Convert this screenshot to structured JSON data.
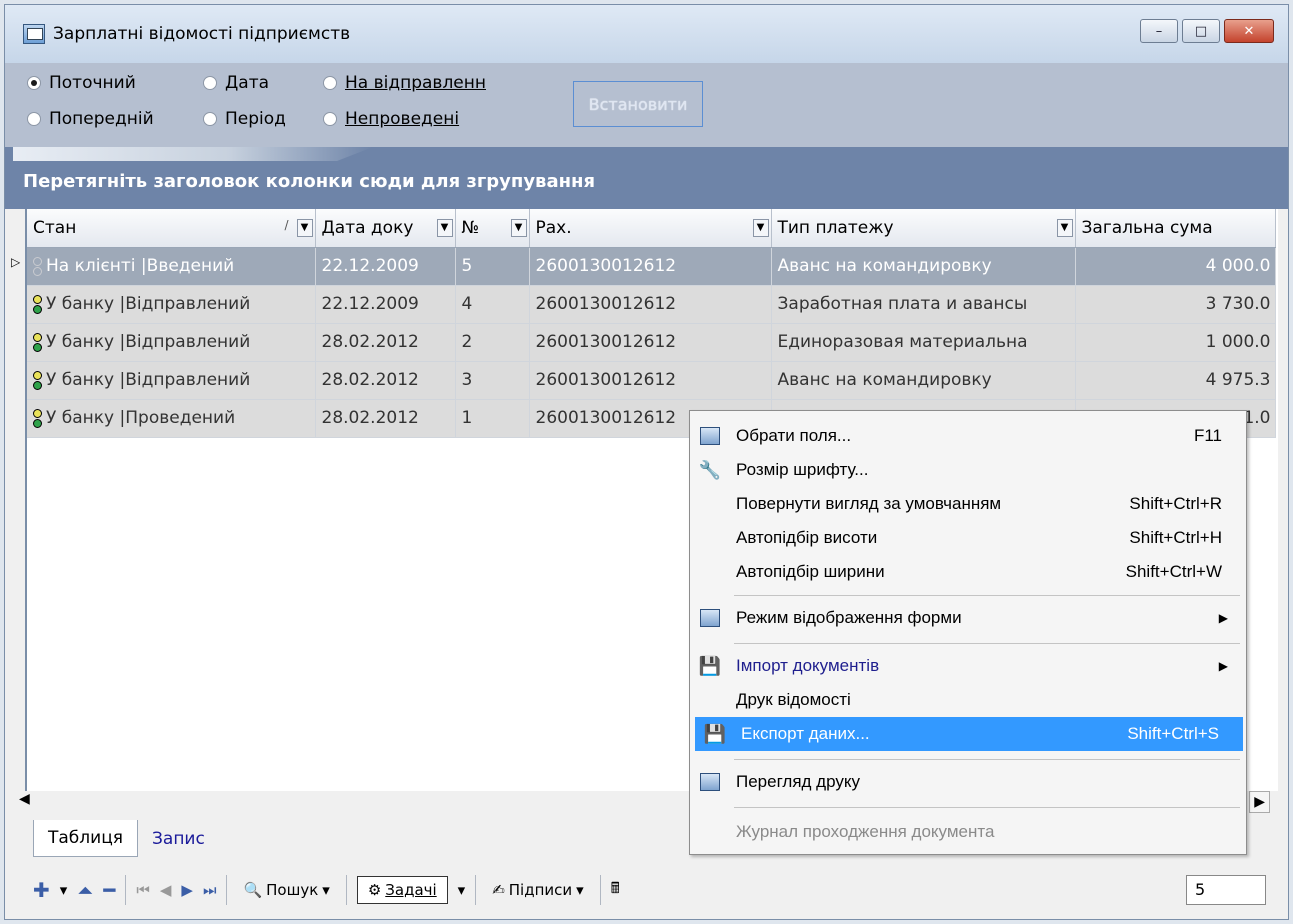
{
  "window": {
    "title": "Зарплатні відомості підприємств",
    "buttons": [
      "–",
      "□",
      "✕"
    ]
  },
  "filters": {
    "radios": [
      {
        "label": "Поточний",
        "checked": true
      },
      {
        "label": "Дата",
        "checked": false
      },
      {
        "label": "На відправленн",
        "checked": false
      },
      {
        "label": "Попередній",
        "checked": false
      },
      {
        "label": "Період",
        "checked": false
      },
      {
        "label": "Непроведені",
        "checked": false
      }
    ],
    "set_button": "Встановити"
  },
  "group_bar": "Перетягніть заголовок колонки сюди для згрупування",
  "table": {
    "columns": [
      "Стан",
      "Дата доку",
      "№",
      "Рах.",
      "Тип платежу",
      "Загальна сума"
    ],
    "rows": [
      [
        "На клієнті |Введений",
        "22.12.2009",
        "5",
        "2600130012612",
        "Аванс на командировку",
        "4 000.0"
      ],
      [
        "У банку |Відправлений",
        "22.12.2009",
        "4",
        "2600130012612",
        "Заработная плата и авансы",
        "3 730.0"
      ],
      [
        "У банку |Відправлений",
        "28.02.2012",
        "2",
        "2600130012612",
        "Единоразовая материальна",
        "1 000.0"
      ],
      [
        "У банку |Відправлений",
        "28.02.2012",
        "3",
        "2600130012612",
        "Аванс на командировку",
        "4 975.3"
      ],
      [
        "У банку |Проведений",
        "28.02.2012",
        "1",
        "2600130012612",
        "",
        "1.0"
      ]
    ],
    "row5_partial_account": "26001300126"
  },
  "tabs": [
    "Таблиця",
    "Запис"
  ],
  "toolbar": {
    "search": "Пошук",
    "tasks": "Задачі",
    "signatures": "Підписи",
    "record_number": "5"
  },
  "context_menu": {
    "items": [
      {
        "label": "Обрати поля...",
        "shortcut": "F11",
        "icon": "fields-icon"
      },
      {
        "label": "Розмір шрифту...",
        "shortcut": "",
        "icon": "wrench-icon"
      },
      {
        "label": "Повернути вигляд за умовчанням",
        "shortcut": "Shift+Ctrl+R"
      },
      {
        "label": "Автопідбір висоти",
        "shortcut": "Shift+Ctrl+H"
      },
      {
        "label": "Автопідбір ширини",
        "shortcut": "Shift+Ctrl+W"
      },
      {
        "label": "Режим відображення форми",
        "shortcut": "",
        "icon": "form-mode-icon",
        "submenu": true
      },
      {
        "label": "Імпорт документів",
        "shortcut": "",
        "icon": "import-icon",
        "submenu": true
      },
      {
        "label": "Друк відомості",
        "shortcut": ""
      },
      {
        "label": "Експорт даних...",
        "shortcut": "Shift+Ctrl+S",
        "icon": "export-icon",
        "highlighted": true
      },
      {
        "label": "Перегляд друку",
        "shortcut": "",
        "icon": "print-preview-icon"
      },
      {
        "label": "Журнал проходження документа",
        "shortcut": "",
        "disabled": true
      }
    ]
  }
}
